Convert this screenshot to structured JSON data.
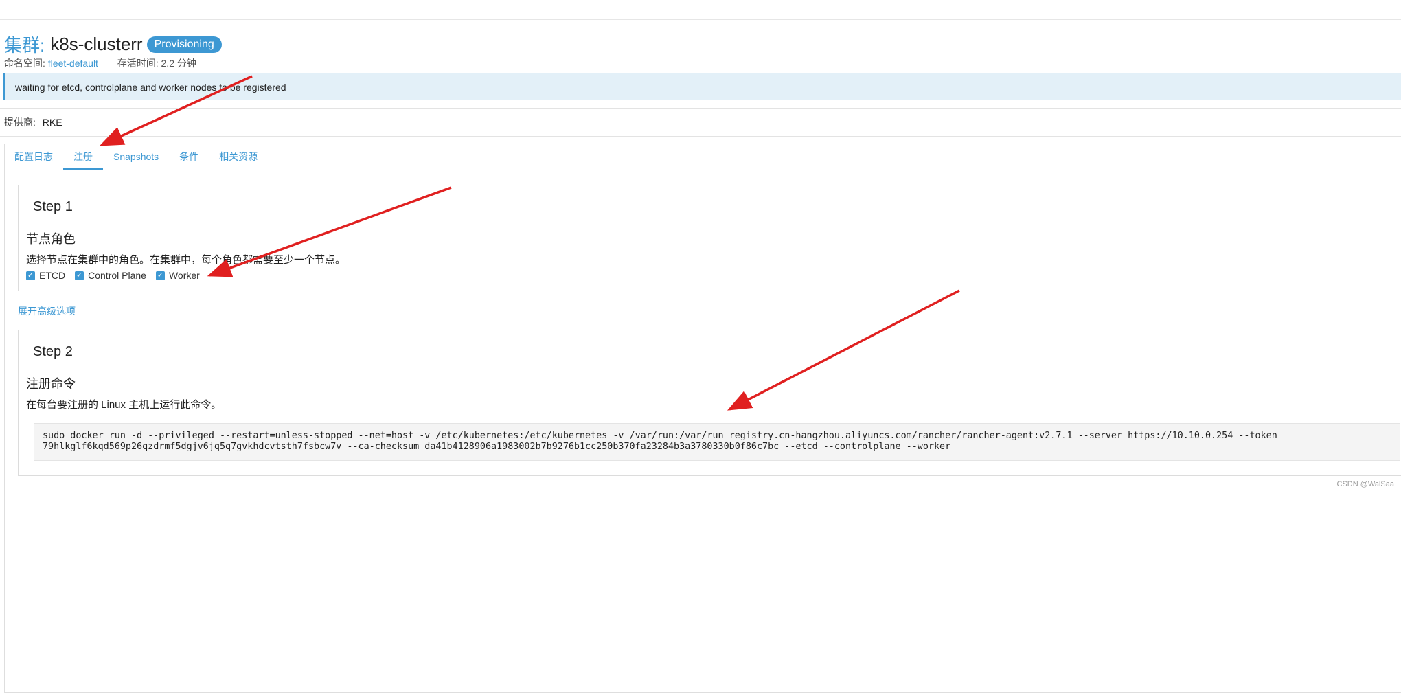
{
  "header": {
    "title_prefix": "集群:",
    "cluster_name": "k8s-clusterr",
    "status_badge": "Provisioning",
    "namespace_label": "命名空间:",
    "namespace_value": "fleet-default",
    "age_label": "存活时间:",
    "age_value": "2.2 分钟"
  },
  "banner": {
    "message": "waiting for etcd, controlplane and worker nodes to be registered"
  },
  "provider": {
    "label": "提供商:",
    "value": "RKE"
  },
  "tabs": [
    {
      "label": "配置日志"
    },
    {
      "label": "注册"
    },
    {
      "label": "Snapshots"
    },
    {
      "label": "条件"
    },
    {
      "label": "相关资源"
    }
  ],
  "active_tab": "注册",
  "step1": {
    "title": "Step 1",
    "section_title": "节点角色",
    "description": "选择节点在集群中的角色。在集群中，每个角色都需要至少一个节点。",
    "roles": [
      {
        "label": "ETCD",
        "checked": true
      },
      {
        "label": "Control Plane",
        "checked": true
      },
      {
        "label": "Worker",
        "checked": true
      }
    ]
  },
  "advanced_link": "展开高级选项",
  "step2": {
    "title": "Step 2",
    "section_title": "注册命令",
    "description": "在每台要注册的 Linux 主机上运行此命令。",
    "command_line1": "sudo docker run -d --privileged --restart=unless-stopped --net=host -v /etc/kubernetes:/etc/kubernetes -v /var/run:/var/run registry.cn-hangzhou.aliyuncs.com/rancher/rancher-agent:v2.7.1 --server https://10.10.0.254 --token",
    "command_line2": "79hlkglf6kqd569p26qzdrmf5dgjv6jq5q7gvkhdcvtsth7fsbcw7v --ca-checksum da41b4128906a1983002b7b9276b1cc250b370fa23284b3a3780330b0f86c7bc --etcd --controlplane --worker"
  },
  "watermark": "CSDN @WalSaa",
  "colors": {
    "accent": "#3d98d3",
    "banner_bg": "#e3f0f8",
    "annotation_arrow": "#e02020"
  }
}
